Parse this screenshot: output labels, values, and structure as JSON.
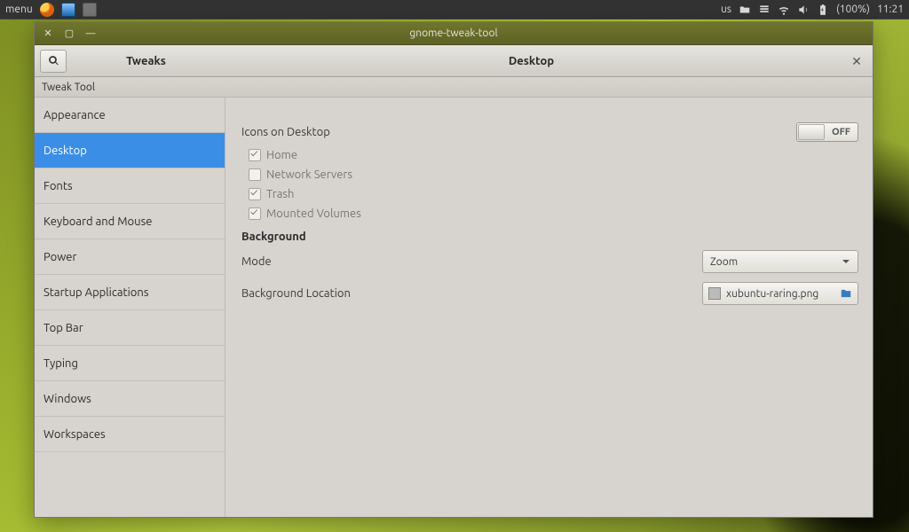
{
  "panel": {
    "menu_label": "menu",
    "keyboard_layout": "us",
    "battery": "(100%)",
    "clock": "11:21"
  },
  "window": {
    "title": "gnome-tweak-tool",
    "app_title": "Tweaks",
    "page_title": "Desktop",
    "tool_label": "Tweak Tool"
  },
  "sidebar": {
    "items": [
      {
        "label": "Appearance"
      },
      {
        "label": "Desktop"
      },
      {
        "label": "Fonts"
      },
      {
        "label": "Keyboard and Mouse"
      },
      {
        "label": "Power"
      },
      {
        "label": "Startup Applications"
      },
      {
        "label": "Top Bar"
      },
      {
        "label": "Typing"
      },
      {
        "label": "Windows"
      },
      {
        "label": "Workspaces"
      }
    ],
    "selected": 1
  },
  "content": {
    "icons_heading": "Icons on Desktop",
    "icons_switch": "OFF",
    "icon_opts": {
      "home": {
        "label": "Home",
        "checked": true
      },
      "network": {
        "label": "Network Servers",
        "checked": false
      },
      "trash": {
        "label": "Trash",
        "checked": true
      },
      "mounted": {
        "label": "Mounted Volumes",
        "checked": true
      }
    },
    "background_heading": "Background",
    "mode_label": "Mode",
    "mode_value": "Zoom",
    "location_label": "Background Location",
    "location_file": "xubuntu-raring.png"
  }
}
